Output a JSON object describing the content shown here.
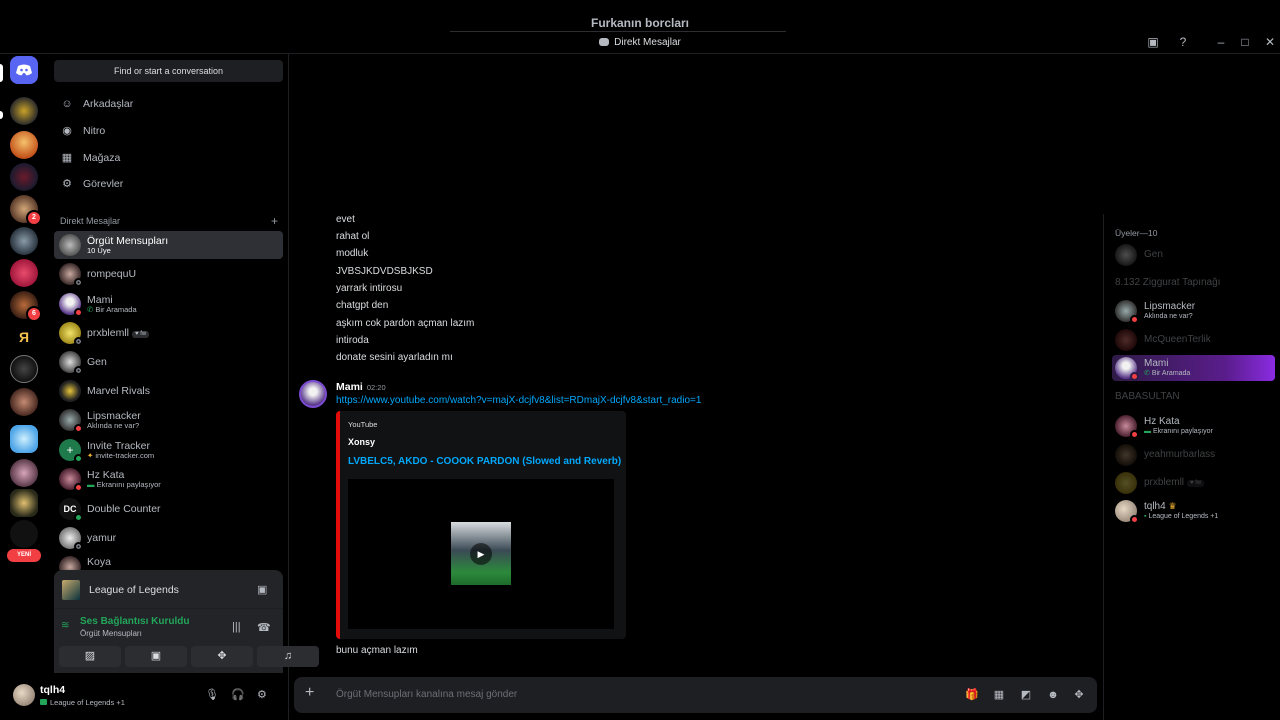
{
  "window": {
    "title": "Furkanın borcları",
    "subtitle": "Direkt Mesajlar"
  },
  "sidebar": {
    "find_button": "Find or start a conversation",
    "nav": [
      "Arkadaşlar",
      "Nitro",
      "Mağaza",
      "Görevler"
    ],
    "dm_header": "Direkt Mesajlar",
    "new_badge": "YENİ",
    "server_badges": [
      "2",
      "6"
    ],
    "dms": [
      {
        "name": "Örgüt Mensupları",
        "sub": "10 Üye"
      },
      {
        "name": "rompequU",
        "sub": ""
      },
      {
        "name": "Mami",
        "sub": "Bir Aramada"
      },
      {
        "name": "prxblemll",
        "sub": "",
        "tag": "fw"
      },
      {
        "name": "Gen",
        "sub": ""
      },
      {
        "name": "Marvel Rivals",
        "sub": ""
      },
      {
        "name": "Lipsmacker",
        "sub": "Aklında ne var?"
      },
      {
        "name": "Invite Tracker",
        "sub": "invite-tracker.com"
      },
      {
        "name": "Hz Kata",
        "sub": "Ekranını paylaşıyor"
      },
      {
        "name": "Double Counter",
        "sub": ""
      },
      {
        "name": "yamur",
        "sub": ""
      },
      {
        "name": "Koya",
        "sub": ""
      }
    ]
  },
  "voice": {
    "game": "League of Legends",
    "status": "Ses Bağlantısı Kuruldu",
    "channel": "Örgüt Mensupları"
  },
  "user": {
    "name": "tqlh4",
    "status": "League of Legends +1"
  },
  "chat": {
    "messages": [
      "evet",
      "rahat ol",
      "modluk",
      "JVBSJKDVDSBJKSD",
      "yarrark intirosu",
      "chatgpt den",
      "aşkım cok pardon açman lazım",
      "intiroda",
      "donate sesini ayarladın mı"
    ],
    "author": "Mami",
    "time": "02:20",
    "link": "https://www.youtube.com/watch?v=majX-dcjfv8&list=RDmajX-dcjfv8&start_radio=1",
    "embed": {
      "provider": "YouTube",
      "author": "Xonsy",
      "title": "LVBELC5, AKDO - COOOK PARDON (Slowed and Reverb)"
    },
    "last_message": "bunu açman lazım",
    "composer_placeholder": "Örgüt Mensupları kanalına mesaj gönder"
  },
  "members": {
    "header": "Üyeler—10",
    "list": [
      {
        "name": "Gen",
        "sub": "",
        "dim": true
      },
      {
        "name": "8.132 Ziggurat Tapınağı",
        "sub": "",
        "dim": true
      },
      {
        "name": "Lipsmacker",
        "sub": "Aklında ne var?",
        "dim": false
      },
      {
        "name": "McQueenTerlik",
        "sub": "",
        "dim": true
      },
      {
        "name": "Mami",
        "sub": "Bir Aramada",
        "dim": false
      },
      {
        "name": "BABASULTAN",
        "sub": "",
        "dim": true
      },
      {
        "name": "Hz Kata",
        "sub": "Ekranını paylaşıyor",
        "dim": false
      },
      {
        "name": "yeahmurbarlass",
        "sub": "",
        "dim": true
      },
      {
        "name": "prxblemll",
        "sub": "",
        "dim": true,
        "tag": "fw"
      },
      {
        "name": "tqlh4",
        "sub": "League of Legends +1",
        "dim": false
      }
    ]
  },
  "colors": {
    "accent": "#5865f2",
    "online": "#23a55a",
    "dnd": "#f23f43",
    "link": "#00a8fc",
    "embed_bar": "#e40b0b"
  }
}
